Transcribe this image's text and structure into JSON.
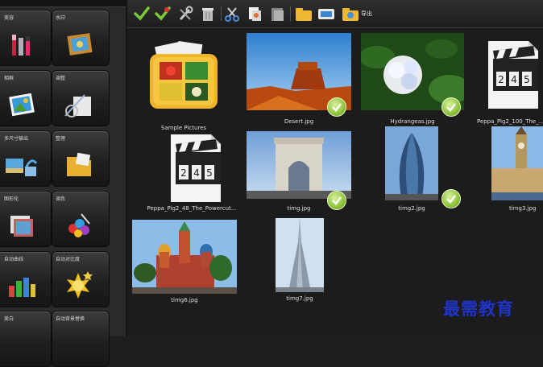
{
  "sidebar": {
    "tiles": [
      {
        "label": "美容"
      },
      {
        "label": "水印"
      },
      {
        "label": "相框"
      },
      {
        "label": "调整"
      },
      {
        "label": "多尺寸输出"
      },
      {
        "label": "整理"
      },
      {
        "label": "图形化"
      },
      {
        "label": "调色"
      },
      {
        "label": "自动曲线"
      },
      {
        "label": "自动对比度"
      },
      {
        "label": "美白"
      },
      {
        "label": "自动背景替换"
      }
    ]
  },
  "toolbar": {
    "export_label": "导出"
  },
  "thumbnails": [
    {
      "caption": "Sample Pictures"
    },
    {
      "caption": "Desert.jpg"
    },
    {
      "caption": "Hydrangeas.jpg"
    },
    {
      "caption": "Peppa_Pig2_100_The_..."
    },
    {
      "caption": "Peppa_Pig2_48_The_Powercut..."
    },
    {
      "caption": "timg.jpg"
    },
    {
      "caption": "timg2.jpg"
    },
    {
      "caption": "timg3.jpg"
    },
    {
      "caption": "timg6.jpg"
    },
    {
      "caption": "timg7.jpg"
    }
  ],
  "clapper_digits": {
    "a": "2",
    "b": "4",
    "c": "5"
  },
  "watermark": "最需教育",
  "colors": {
    "check_green": "#8fc43a",
    "watermark_blue": "#2033c8",
    "background": "#1c1c1c"
  }
}
